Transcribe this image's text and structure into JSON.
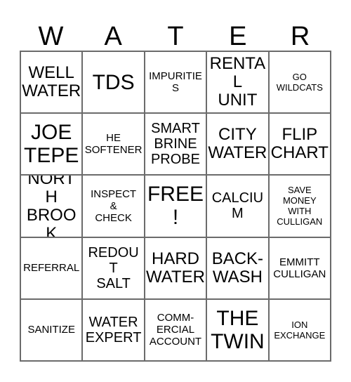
{
  "card": {
    "title_letters": [
      "W",
      "A",
      "T",
      "E",
      "R"
    ],
    "grid_columns": 5,
    "grid_rows": 5,
    "border_color": "#6b6b6b",
    "text_color": "#000000",
    "background_color": "#ffffff",
    "rows": [
      [
        {
          "text": "WELL\nWATER",
          "size": "lg",
          "marked": false
        },
        {
          "text": "TDS",
          "size": "xl",
          "marked": false
        },
        {
          "text": "IMPURITIES",
          "size": "sm",
          "marked": false
        },
        {
          "text": "RENTAL\nUNIT",
          "size": "lg",
          "marked": false
        },
        {
          "text": "GO\nWILDCATS",
          "size": "xs",
          "marked": false
        }
      ],
      [
        {
          "text": "JOE\nTEPE",
          "size": "xl",
          "marked": false
        },
        {
          "text": "HE\nSOFTENER",
          "size": "sm",
          "marked": false
        },
        {
          "text": "SMART\nBRINE\nPROBE",
          "size": "md",
          "marked": false
        },
        {
          "text": "CITY\nWATER",
          "size": "lg",
          "marked": false
        },
        {
          "text": "FLIP\nCHART",
          "size": "lg",
          "marked": false
        }
      ],
      [
        {
          "text": "NORTH\nBROOK",
          "size": "lg",
          "marked": false
        },
        {
          "text": "INSPECT\n&\nCHECK",
          "size": "sm",
          "marked": false
        },
        {
          "text": "FREE!",
          "size": "xl",
          "marked": false
        },
        {
          "text": "CALCIUM",
          "size": "md",
          "marked": false
        },
        {
          "text": "SAVE\nMONEY\nWITH\nCULLIGAN",
          "size": "xs",
          "marked": false
        }
      ],
      [
        {
          "text": "REFERRAL",
          "size": "sm",
          "marked": false
        },
        {
          "text": "REDOUT\nSALT",
          "size": "md",
          "marked": false
        },
        {
          "text": "HARD\nWATER",
          "size": "lg",
          "marked": false
        },
        {
          "text": "BACK-\nWASH",
          "size": "lg",
          "marked": false
        },
        {
          "text": "EMMITT\nCULLIGAN",
          "size": "sm",
          "marked": false
        }
      ],
      [
        {
          "text": "SANITIZE",
          "size": "sm",
          "marked": false
        },
        {
          "text": "WATER\nEXPERT",
          "size": "md",
          "marked": false
        },
        {
          "text": "COMM-\nERCIAL\nACCOUNT",
          "size": "sm",
          "marked": false
        },
        {
          "text": "THE\nTWIN",
          "size": "xl",
          "marked": false
        },
        {
          "text": "ION\nEXCHANGE",
          "size": "xs",
          "marked": false
        }
      ]
    ]
  }
}
